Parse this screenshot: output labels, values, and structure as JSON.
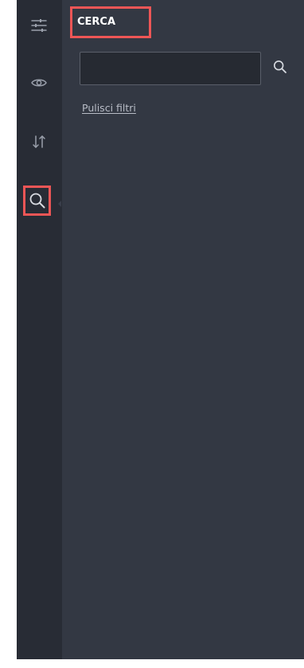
{
  "panel": {
    "title": "CERCA",
    "search": {
      "value": "",
      "placeholder": "",
      "submit_icon": "search-icon"
    },
    "clear_filters_label": "Pulisci filtri"
  },
  "rail": {
    "items": [
      {
        "icon": "sliders-icon",
        "active": false
      },
      {
        "icon": "eye-icon",
        "active": false
      },
      {
        "icon": "sort-arrows-icon",
        "active": false
      },
      {
        "icon": "search-icon",
        "active": true
      }
    ]
  },
  "colors": {
    "rail_bg": "#282c35",
    "panel_bg": "#333843",
    "input_bg": "#262a32",
    "highlight": "#ee5656",
    "icon": "#9aa0ab",
    "link": "#b8bcc6"
  }
}
